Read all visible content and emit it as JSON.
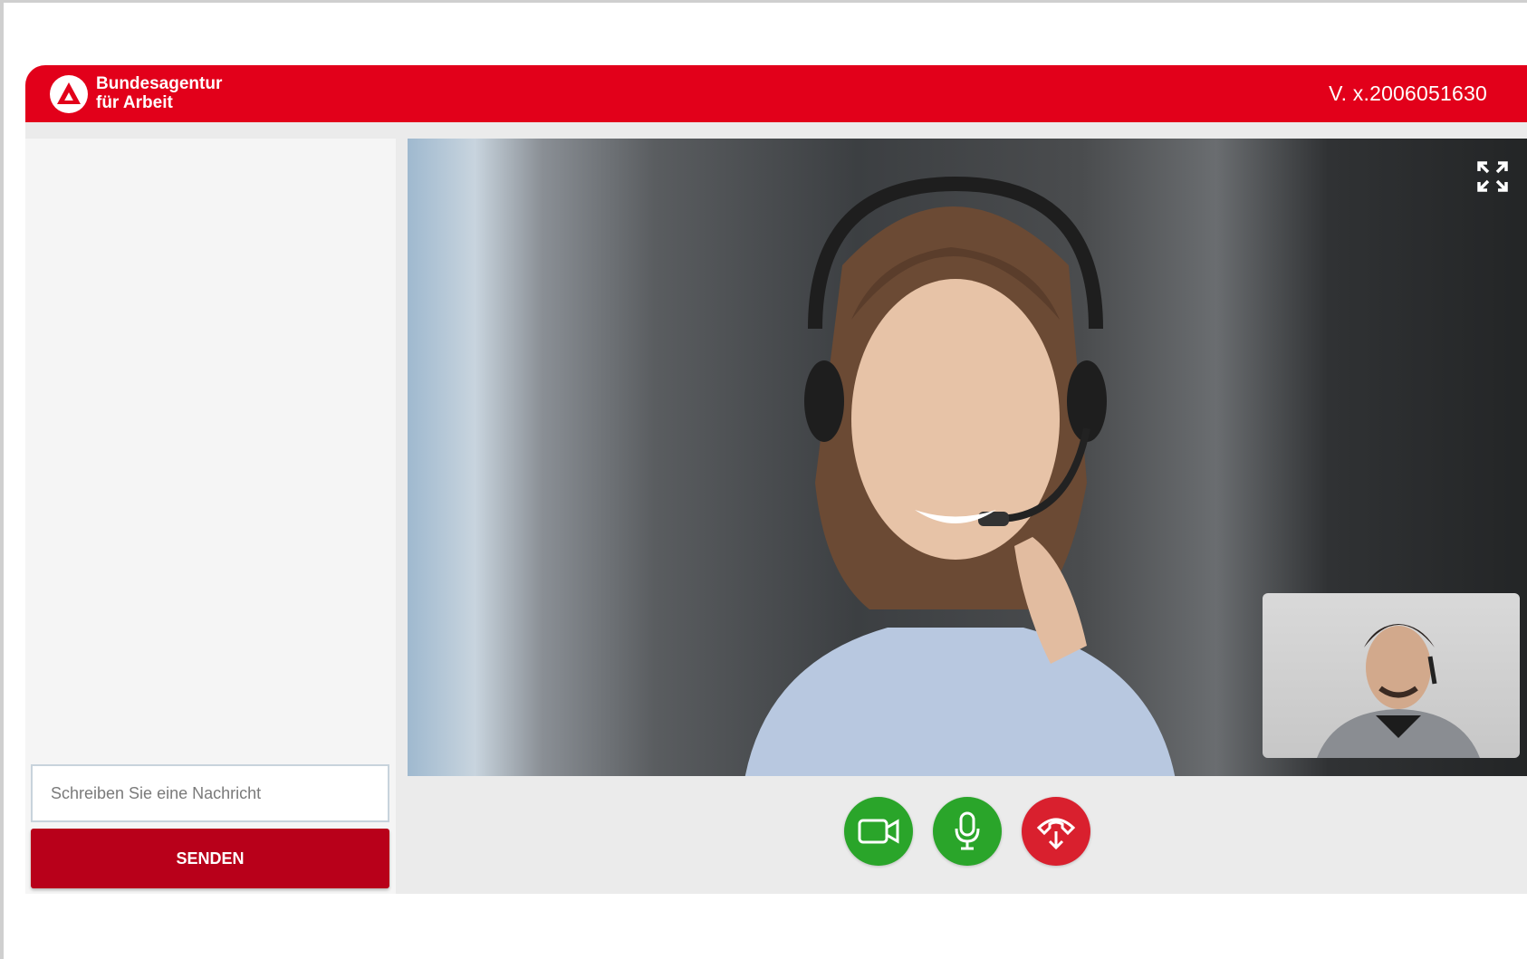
{
  "header": {
    "brand_line1": "Bundesagentur",
    "brand_line2": "für Arbeit",
    "version": "V. x.2006051630",
    "brand_color": "#e2001a"
  },
  "chat": {
    "placeholder": "Schreiben Sie eine Nachricht",
    "send_label": "SENDEN",
    "send_color": "#b8001a"
  },
  "video": {
    "fullscreen_icon": "fullscreen-expand-icon"
  },
  "controls": {
    "camera_icon": "video-camera-icon",
    "camera_color": "#2aa52a",
    "mic_icon": "microphone-icon",
    "mic_color": "#2aa52a",
    "hangup_icon": "hang-up-icon",
    "hangup_color": "#d9202e"
  }
}
